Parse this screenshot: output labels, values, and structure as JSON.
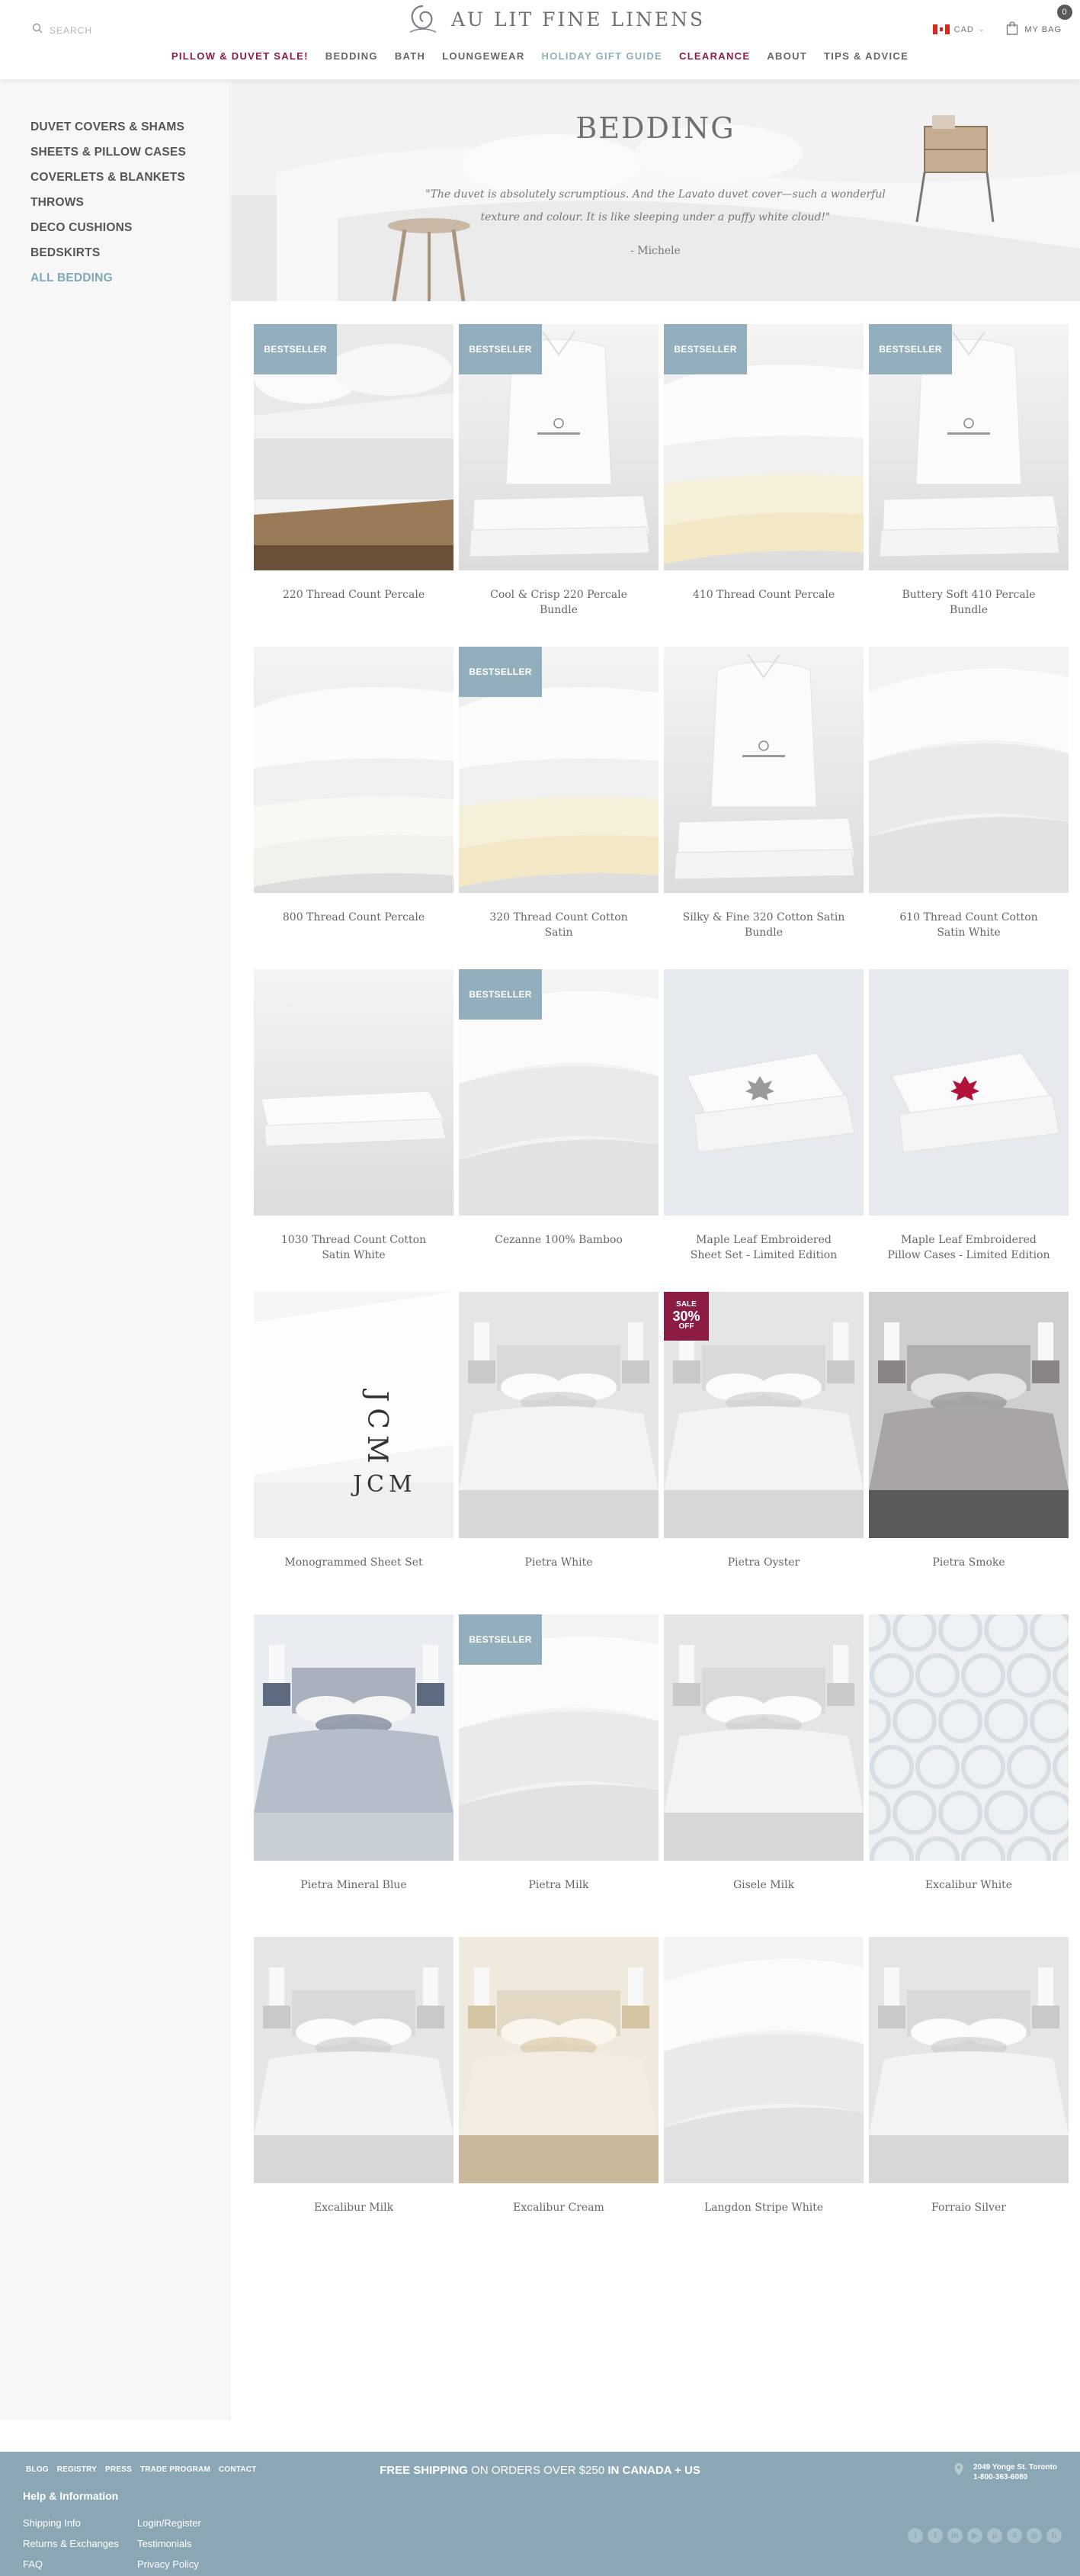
{
  "header": {
    "search_placeholder": "SEARCH",
    "logo_text": "AU LIT FINE LINENS",
    "currency": "CAD",
    "bag_label": "MY BAG",
    "bag_count": "0"
  },
  "nav": [
    {
      "label": "PILLOW & DUVET SALE!",
      "style": "sale"
    },
    {
      "label": "BEDDING",
      "style": "normal"
    },
    {
      "label": "BATH",
      "style": "normal"
    },
    {
      "label": "LOUNGEWEAR",
      "style": "normal"
    },
    {
      "label": "HOLIDAY GIFT GUIDE",
      "style": "holiday"
    },
    {
      "label": "CLEARANCE",
      "style": "sale"
    },
    {
      "label": "ABOUT",
      "style": "normal"
    },
    {
      "label": "TIPS & ADVICE",
      "style": "normal"
    }
  ],
  "sidebar": {
    "items": [
      {
        "label": "DUVET COVERS & SHAMS",
        "active": false
      },
      {
        "label": "SHEETS & PILLOW CASES",
        "active": false
      },
      {
        "label": "COVERLETS & BLANKETS",
        "active": false
      },
      {
        "label": "THROWS",
        "active": false
      },
      {
        "label": "DECO CUSHIONS",
        "active": false
      },
      {
        "label": "BEDSKIRTS",
        "active": false
      },
      {
        "label": "ALL BEDDING",
        "active": true
      }
    ]
  },
  "hero": {
    "title": "BEDDING",
    "quote": "\"The duvet is absolutely scrumptious. And the Lavato duvet cover—such a wonderful texture and colour. It is like sleeping under a puffy white cloud!\"",
    "author": "- Michele"
  },
  "products": [
    {
      "name": "220 Thread Count Percale",
      "badge": "BESTSELLER",
      "image": "bed-wood-frame"
    },
    {
      "name": "Cool & Crisp 220 Percale Bundle",
      "badge": "BESTSELLER",
      "image": "bag-bundle"
    },
    {
      "name": "410 Thread Count Percale",
      "badge": "BESTSELLER",
      "image": "folded-stack-cream"
    },
    {
      "name": "Buttery Soft 410 Percale Bundle",
      "badge": "BESTSELLER",
      "image": "bag-bundle"
    },
    {
      "name": "800 Thread Count Percale",
      "badge": "",
      "image": "folded-stack"
    },
    {
      "name": "320 Thread Count Cotton Satin",
      "badge": "BESTSELLER",
      "image": "folded-stack-cream"
    },
    {
      "name": "Silky & Fine 320 Cotton Satin Bundle",
      "badge": "",
      "image": "bag-bundle"
    },
    {
      "name": "610 Thread Count Cotton Satin White",
      "badge": "",
      "image": "fabric-closeup"
    },
    {
      "name": "1030 Thread Count Cotton Satin White",
      "badge": "",
      "image": "folded-flat"
    },
    {
      "name": "Cezanne 100% Bamboo",
      "badge": "BESTSELLER",
      "image": "fabric-closeup"
    },
    {
      "name": "Maple Leaf Embroidered Sheet Set - Limited Edition",
      "badge": "",
      "image": "folded-leaf"
    },
    {
      "name": "Maple Leaf Embroidered Pillow Cases - Limited Edition",
      "badge": "",
      "image": "pillow-leaf"
    },
    {
      "name": "Monogrammed Sheet Set",
      "badge": "",
      "image": "monogram"
    },
    {
      "name": "Pietra White",
      "badge": "",
      "image": "bed-room-light"
    },
    {
      "name": "Pietra Oyster",
      "badge": "SALE",
      "sale": {
        "top": "SALE",
        "pct": "30%",
        "bottom": "OFF"
      },
      "image": "bed-room-light"
    },
    {
      "name": "Pietra Smoke",
      "badge": "",
      "image": "bed-room-dark"
    },
    {
      "name": "Pietra Mineral Blue",
      "badge": "",
      "image": "bed-room-blue"
    },
    {
      "name": "Pietra Milk",
      "badge": "BESTSELLER",
      "image": "fabric-closeup"
    },
    {
      "name": "Gisele Milk",
      "badge": "",
      "image": "bed-room-light"
    },
    {
      "name": "Excalibur White",
      "badge": "",
      "image": "pattern"
    },
    {
      "name": "Excalibur Milk",
      "badge": "",
      "image": "bed-room-light"
    },
    {
      "name": "Excalibur Cream",
      "badge": "",
      "image": "bed-room-cream"
    },
    {
      "name": "Langdon Stripe White",
      "badge": "",
      "image": "fabric-closeup"
    },
    {
      "name": "Forraio Silver",
      "badge": "",
      "image": "bed-room-light"
    }
  ],
  "footer": {
    "links": [
      "BLOG",
      "REGISTRY",
      "PRESS",
      "TRADE PROGRAM",
      "CONTACT"
    ],
    "shipping_1": "FREE SHIPPING",
    "shipping_2": " ON ORDERS OVER $250 ",
    "shipping_3": "IN CANADA + US",
    "address_1": "2049 Yonge St. Toronto",
    "address_2": "1-800-363-6080",
    "help_title": "Help & Information",
    "col1": [
      "Shipping Info",
      "Returns & Exchanges",
      "FAQ"
    ],
    "col2": [
      "Login/Register",
      "Testimonials",
      "Privacy Policy"
    ],
    "social": [
      "twitter-icon",
      "facebook-icon",
      "linkedin-icon",
      "youtube-icon",
      "pinterest-icon",
      "foursquare-icon",
      "instagram-icon",
      "houzz-icon"
    ]
  },
  "colors": {
    "accent_sale": "#8c1c44",
    "accent_blue": "#8eb0bd",
    "badge_blue": "#93afbd",
    "footer_bg": "#8ba7b5"
  }
}
